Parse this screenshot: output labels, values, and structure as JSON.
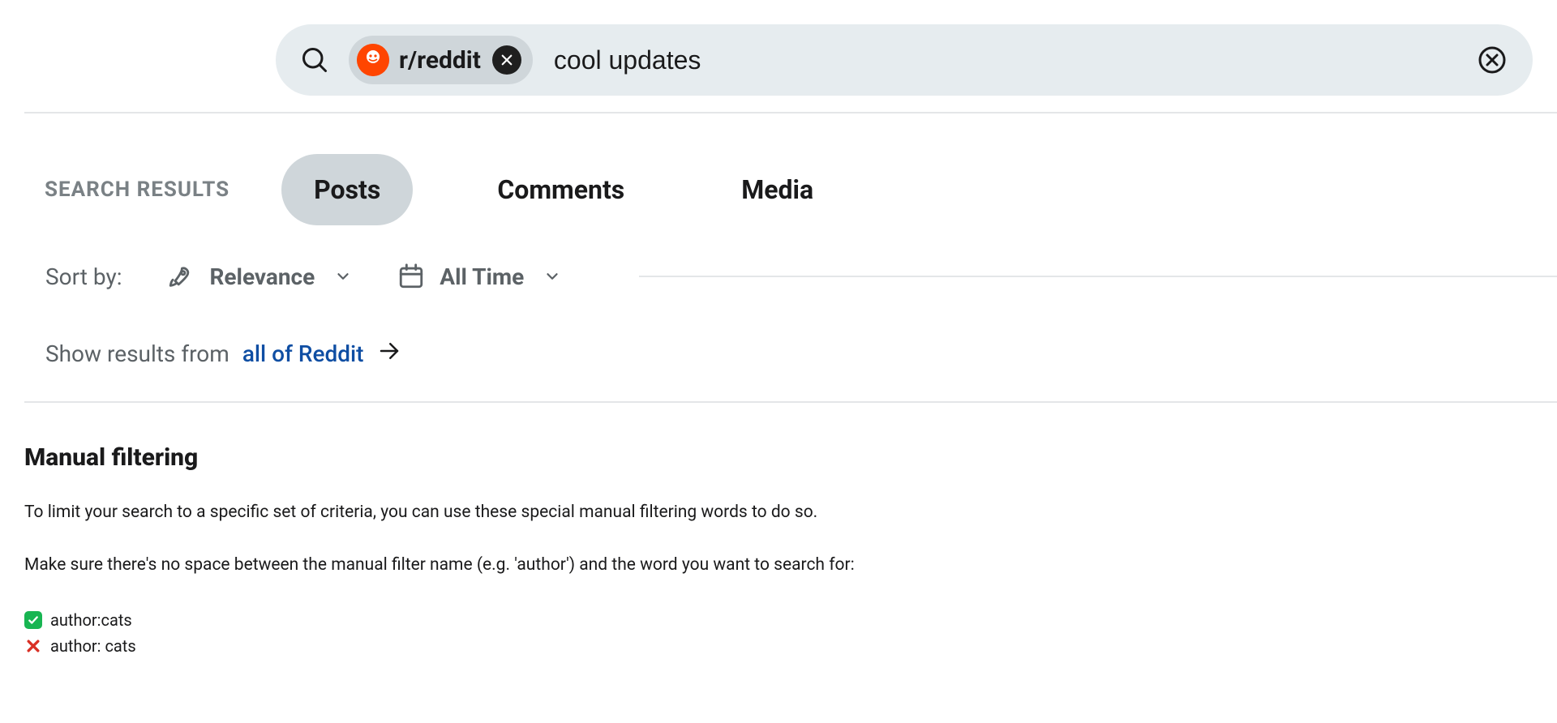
{
  "search": {
    "subreddit": "r/reddit",
    "query": "cool updates"
  },
  "tabs": {
    "heading": "SEARCH RESULTS",
    "items": [
      "Posts",
      "Comments",
      "Media"
    ],
    "active_index": 0
  },
  "sort": {
    "label": "Sort by:",
    "main": "Relevance",
    "time": "All Time"
  },
  "showfrom": {
    "label": "Show results from",
    "link": "all of Reddit"
  },
  "manual": {
    "heading": "Manual filtering",
    "p1": "To limit your search to a specific set of criteria, you can use these special manual filtering words to do so.",
    "p2": "Make sure there's no space between the manual filter name (e.g. 'author') and the word you want to search for:",
    "good": "author:cats",
    "bad": "author: cats"
  }
}
